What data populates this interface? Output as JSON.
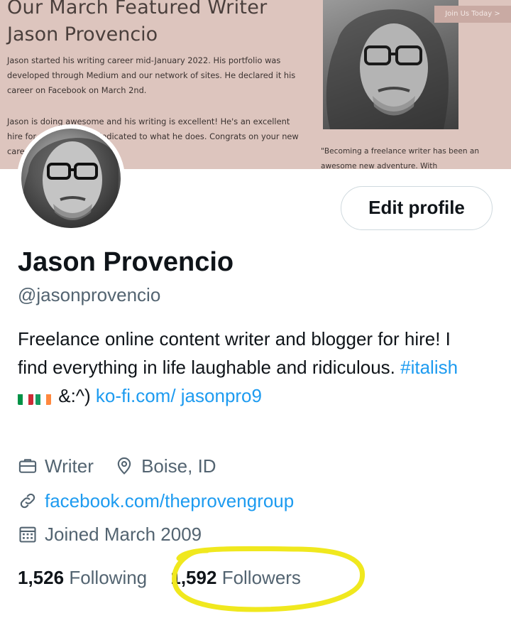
{
  "banner": {
    "title": "Our March Featured Writer",
    "name": "Jason Provencio",
    "paragraph1": "Jason started his writing career mid-January 2022. His portfolio was developed through Medium and our network of sites. He declared it his career on Facebook on March 2nd.",
    "paragraph2": "Jason is doing awesome and his writing is excellent! He's an excellent hire for anyone. He is dedicated to what he does. Congrats on your new career!",
    "join_button": "Join Us Today >",
    "quote": "\"Becoming a freelance writer has been an awesome new adventure. With"
  },
  "profile": {
    "edit_button": "Edit profile",
    "display_name": "Jason Provencio",
    "handle": "@jasonprovencio",
    "bio_text_1": "Freelance online content writer and blogger for hire! I find everything in life laughable and ridiculous. ",
    "bio_hashtag": "#italish",
    "bio_text_2": " &:^) ",
    "bio_link": "ko-fi.com/ jasonpro9",
    "profession": "Writer",
    "location": "Boise, ID",
    "website": "facebook.com/theprovengroup",
    "joined": "Joined March 2009",
    "following_count": "1,526",
    "following_label": "Following",
    "followers_count": "1,592",
    "followers_label": "Followers"
  },
  "colors": {
    "banner_bg": "#ddc5be",
    "link": "#1d9bf0",
    "secondary_text": "#536471",
    "annotation": "#f0e81e"
  },
  "icons": [
    "briefcase-icon",
    "location-pin-icon",
    "link-icon",
    "calendar-icon"
  ]
}
